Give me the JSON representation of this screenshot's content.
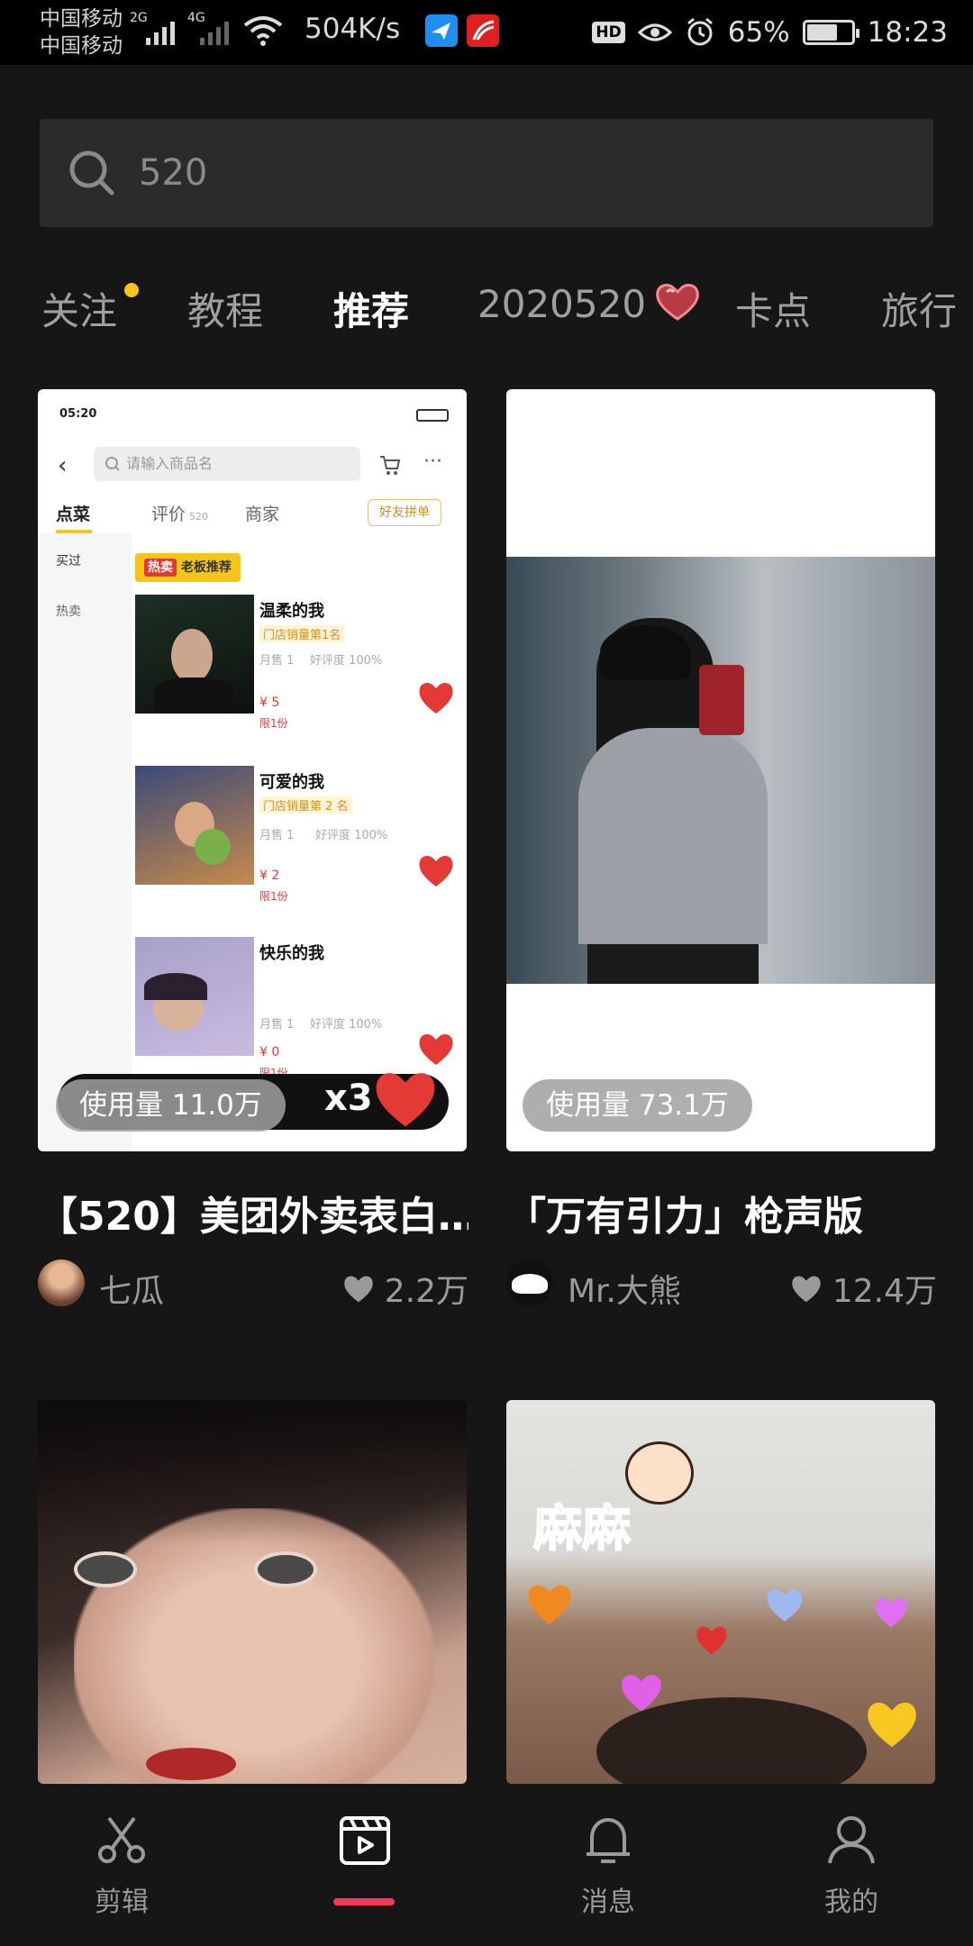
{
  "status_bar": {
    "carrier_1": "中国移动",
    "carrier_2": "中国移动",
    "signal_1_type": "2G",
    "signal_2_type": "4G",
    "net_speed": "504K/s",
    "hd_badge": "HD",
    "battery_percent": "65%",
    "battery_level": 0.65,
    "time": "18:23"
  },
  "search": {
    "value": "520"
  },
  "tabs": [
    {
      "label": "关注",
      "has_dot": true
    },
    {
      "label": "教程"
    },
    {
      "label": "推荐",
      "active": true
    },
    {
      "label": "2020520",
      "icon": "heart-icon"
    },
    {
      "label": "卡点"
    },
    {
      "label": "旅行"
    }
  ],
  "cards": [
    {
      "usage": "使用量 11.0万",
      "title": "【520】美团外卖表白…",
      "author": "七瓜",
      "likes": "2.2万",
      "overlay_text": "x3",
      "mock": {
        "time": "05:20",
        "search_placeholder": "请输入商品名",
        "tab_1": "点菜",
        "tab_2": "评价",
        "tab_2_count": "520",
        "tab_3": "商家",
        "group_buy": "好友拼单",
        "side_1": "买过",
        "side_2": "热卖",
        "hot_tag": "热卖",
        "boss_tag": "老板推荐",
        "items": [
          {
            "name": "温柔的我",
            "badge": "门店销量第1名",
            "sales": "月售 1",
            "rating": "好评度 100%",
            "price": "¥ 5",
            "limit": "限1份"
          },
          {
            "name": "可爱的我",
            "badge": "门店销量第 2 名",
            "sales": "月售 1",
            "rating": "好评度 100%",
            "price": "¥ 2",
            "limit": "限1份"
          },
          {
            "name": "快乐的我",
            "sales": "月售 1",
            "rating": "好评度 100%",
            "price": "¥ 0",
            "limit": "限1份"
          }
        ]
      }
    },
    {
      "usage": "使用量 73.1万",
      "title": "「万有引力」枪声版",
      "author": "Mr.大熊",
      "likes": "12.4万"
    },
    {},
    {
      "sticker_text": "麻麻"
    }
  ],
  "bottom_nav": [
    {
      "label": "剪辑",
      "icon": "scissors-icon"
    },
    {
      "label": "",
      "icon": "template-play-icon",
      "active": true
    },
    {
      "label": "消息",
      "icon": "bell-icon"
    },
    {
      "label": "我的",
      "icon": "person-icon"
    }
  ],
  "colors": {
    "background": "#161616",
    "accent": "#f5385a",
    "dot": "#f5c518"
  }
}
